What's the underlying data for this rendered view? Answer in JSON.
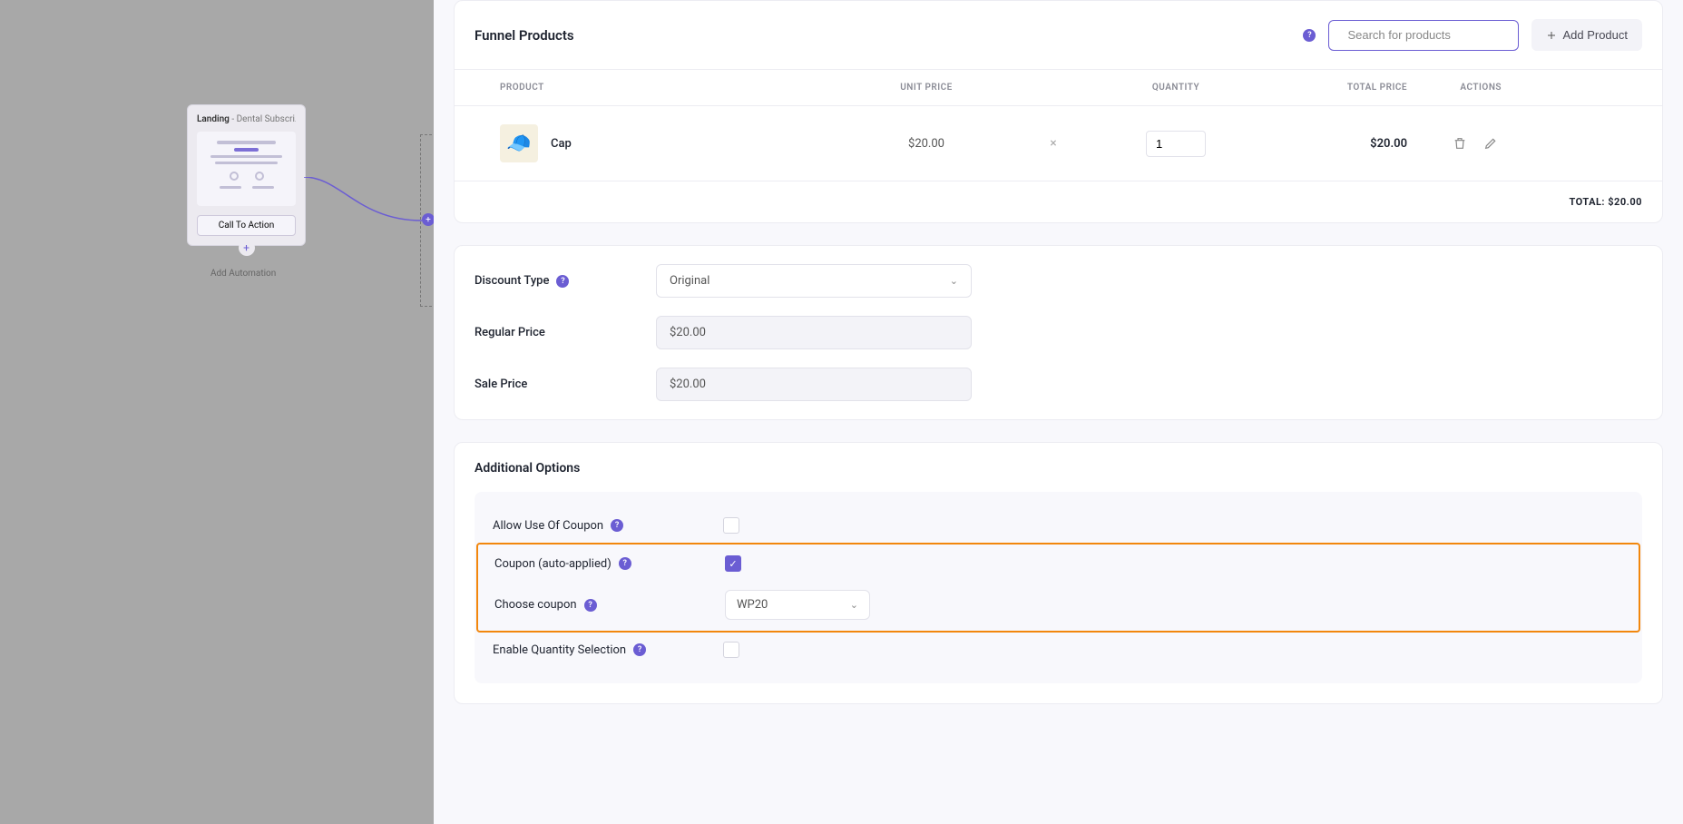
{
  "canvas": {
    "node": {
      "title": "Landing",
      "subtitle": " - Dental Subscri...",
      "cta": "Call To Action"
    },
    "add_automation": "Add Automation"
  },
  "funnel_products": {
    "title": "Funnel Products",
    "search_placeholder": "Search for products",
    "add_product": "Add Product",
    "columns": {
      "product": "PRODUCT",
      "unit_price": "UNIT PRICE",
      "quantity": "QUANTITY",
      "total_price": "TOTAL PRICE",
      "actions": "ACTIONS"
    },
    "rows": [
      {
        "name": "Cap",
        "unit_price": "$20.00",
        "qty": "1",
        "total": "$20.00"
      }
    ],
    "total_label": "TOTAL: $20.00"
  },
  "discount": {
    "type_label": "Discount Type",
    "type_value": "Original",
    "regular_label": "Regular Price",
    "regular_value": "$20.00",
    "sale_label": "Sale Price",
    "sale_value": "$20.00"
  },
  "additional": {
    "title": "Additional Options",
    "allow_coupon": "Allow Use Of Coupon",
    "coupon_auto": "Coupon (auto-applied)",
    "choose_coupon": "Choose coupon",
    "coupon_value": "WP20",
    "enable_qty": "Enable Quantity Selection"
  }
}
